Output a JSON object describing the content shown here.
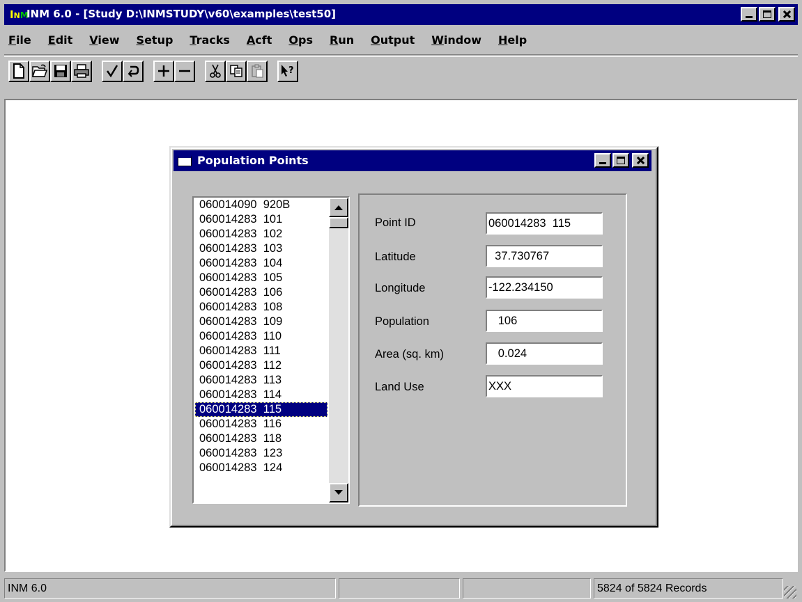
{
  "app": {
    "title": "INM 6.0 - [Study D:\\INMSTUDY\\v60\\examples\\test50]",
    "icon_letters": [
      "I",
      "N",
      "M"
    ]
  },
  "menu": [
    {
      "label": "File",
      "mnemonic": "F"
    },
    {
      "label": "Edit",
      "mnemonic": "E"
    },
    {
      "label": "View",
      "mnemonic": "V"
    },
    {
      "label": "Setup",
      "mnemonic": "S"
    },
    {
      "label": "Tracks",
      "mnemonic": "T"
    },
    {
      "label": "Acft",
      "mnemonic": "A"
    },
    {
      "label": "Ops",
      "mnemonic": "O"
    },
    {
      "label": "Run",
      "mnemonic": "R"
    },
    {
      "label": "Output",
      "mnemonic": "O"
    },
    {
      "label": "Window",
      "mnemonic": "W"
    },
    {
      "label": "Help",
      "mnemonic": "H"
    }
  ],
  "toolbar": {
    "icons": [
      "new-file-icon",
      "open-folder-icon",
      "save-icon",
      "print-icon",
      "check-icon",
      "undo-icon",
      "plus-icon",
      "minus-icon",
      "cut-icon",
      "copy-icon",
      "paste-icon",
      "context-help-icon"
    ]
  },
  "dialog": {
    "title": "Population Points",
    "list": [
      "060014090  920B",
      "060014283  101",
      "060014283  102",
      "060014283  103",
      "060014283  104",
      "060014283  105",
      "060014283  106",
      "060014283  108",
      "060014283  109",
      "060014283  110",
      "060014283  111",
      "060014283  112",
      "060014283  113",
      "060014283  114",
      "060014283  115",
      "060014283  116",
      "060014283  118",
      "060014283  123",
      "060014283  124"
    ],
    "selected_index": 14,
    "fields": {
      "point_id": {
        "label": "Point ID",
        "value": "060014283  115"
      },
      "latitude": {
        "label": "Latitude",
        "value": "  37.730767"
      },
      "longitude": {
        "label": "Longitude",
        "value": "-122.234150"
      },
      "population": {
        "label": "Population",
        "value": "   106"
      },
      "area": {
        "label": "Area (sq. km)",
        "value": "   0.024"
      },
      "land_use": {
        "label": "Land Use",
        "value": "XXX"
      }
    }
  },
  "status": {
    "app_label": "INM 6.0",
    "panel2": "",
    "panel3": "",
    "records": "5824 of 5824  Records"
  }
}
